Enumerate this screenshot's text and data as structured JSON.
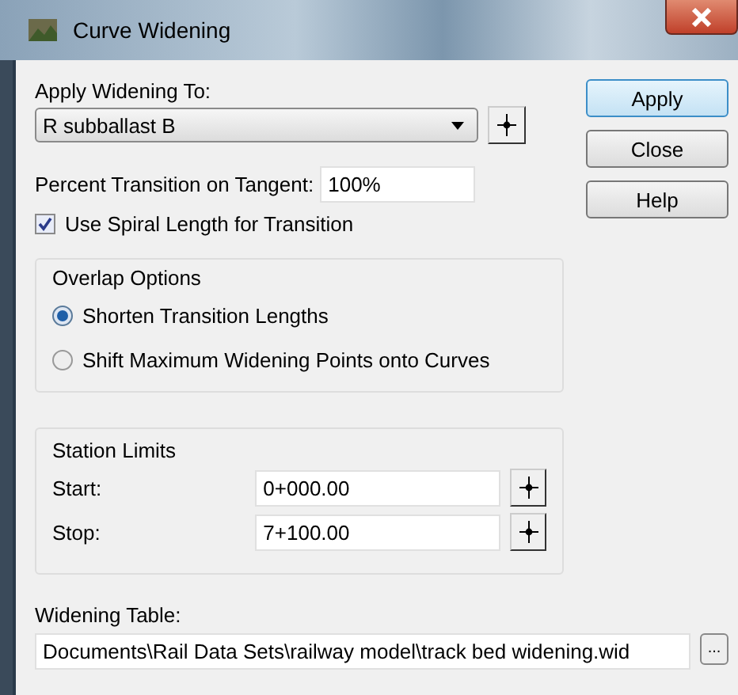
{
  "window": {
    "title": "Curve Widening"
  },
  "apply_widening_to": {
    "label": "Apply Widening To:",
    "value": "R subballast B"
  },
  "percent_transition": {
    "label": "Percent Transition on Tangent:",
    "value": "100%"
  },
  "use_spiral": {
    "label": "Use Spiral Length for Transition",
    "checked": true
  },
  "overlap_options": {
    "title": "Overlap Options",
    "options": [
      {
        "label": "Shorten Transition Lengths",
        "selected": true
      },
      {
        "label": "Shift Maximum Widening Points onto Curves",
        "selected": false
      }
    ]
  },
  "station_limits": {
    "title": "Station Limits",
    "fields": [
      {
        "label": "Start:",
        "value": "0+000.00"
      },
      {
        "label": "Stop:",
        "value": "7+100.00"
      }
    ]
  },
  "widening_table": {
    "label": "Widening Table:",
    "value": "Documents\\Rail Data Sets\\railway model\\track bed widening.wid",
    "browse": "..."
  },
  "buttons": [
    {
      "label": "Apply",
      "default": true
    },
    {
      "label": "Close",
      "default": false
    },
    {
      "label": "Help",
      "default": false
    }
  ]
}
